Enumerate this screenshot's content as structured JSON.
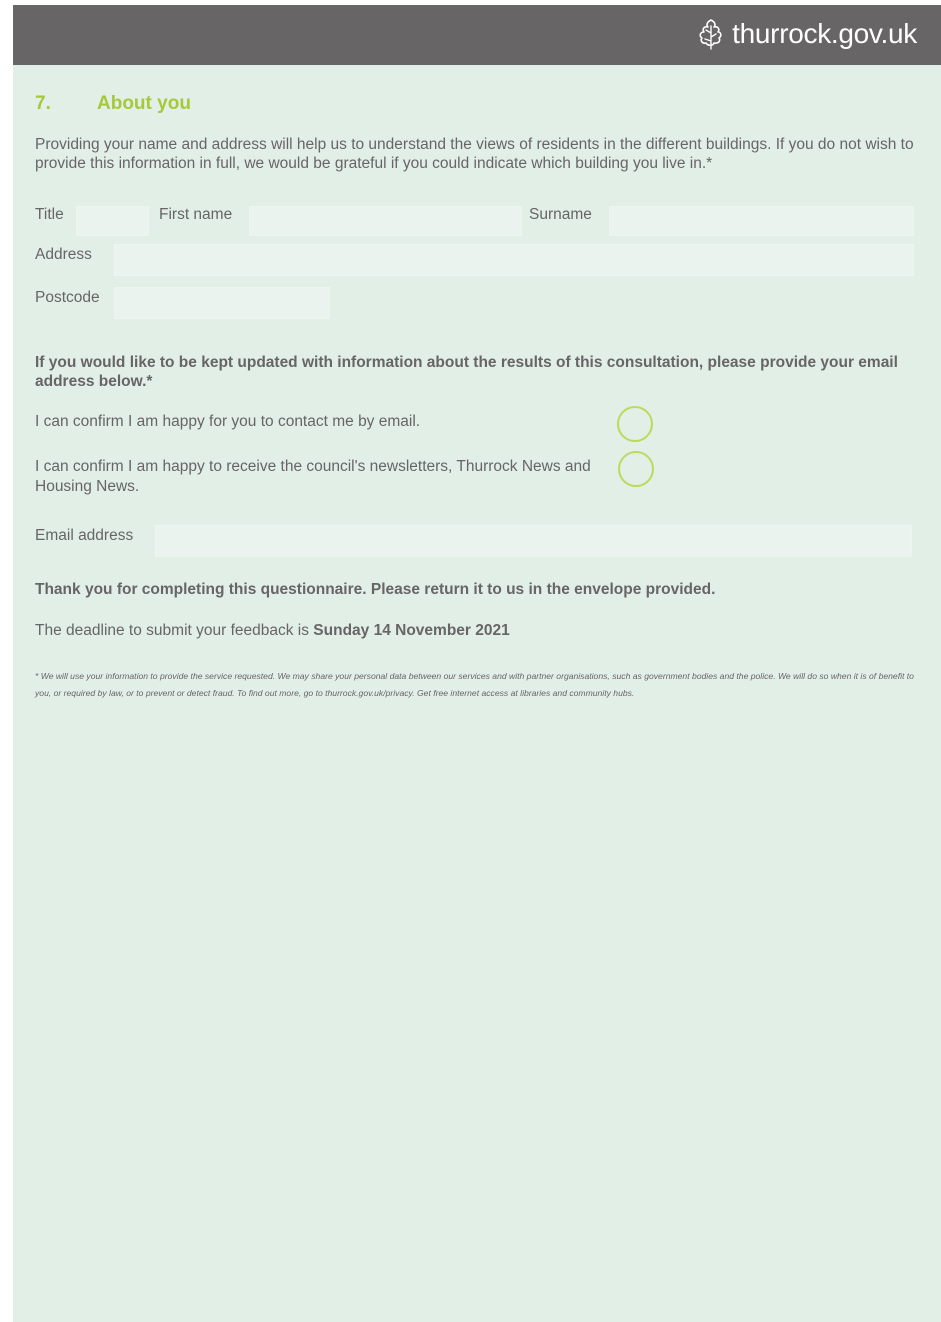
{
  "header": {
    "logo_text": "thurrock.gov.uk",
    "logo_icon": "oak-leaf-icon",
    "bar_color": "#676566"
  },
  "section": {
    "number": "7.",
    "title": "About you",
    "accent_color": "#a6c83b"
  },
  "intro": "Providing your name and address will help us to understand the views of residents in the different buildings. If you do not wish to provide this information in full, we would be grateful if you could indicate which building you live in.*",
  "fields": {
    "title_label": "Title",
    "first_name_label": "First name",
    "surname_label": "Surname",
    "address_label": "Address",
    "postcode_label": "Postcode",
    "email_label": "Email address"
  },
  "updates_prompt": "If you would like to be kept updated with information about the results of this consultation, please provide your email address below.*",
  "consents": {
    "email_contact": "I can confirm I am happy for you to contact me by email.",
    "newsletters": "I can confirm I am happy to receive the council's newsletters, Thurrock News and Housing News."
  },
  "thank_you": "Thank you for completing this questionnaire. Please return it to us in the envelope provided.",
  "deadline": {
    "prefix": "The deadline to submit your feedback is ",
    "date": "Sunday 14 November 2021"
  },
  "footnote": "* We will use your information to provide the service requested. We may share your personal data between our services and with partner organisations, such as government bodies and the police. We will do so when it is of benefit to you, or required by law, or to prevent or detect fraud. To find out more, go to thurrock.gov.uk/privacy. Get free internet access at libraries and community hubs."
}
